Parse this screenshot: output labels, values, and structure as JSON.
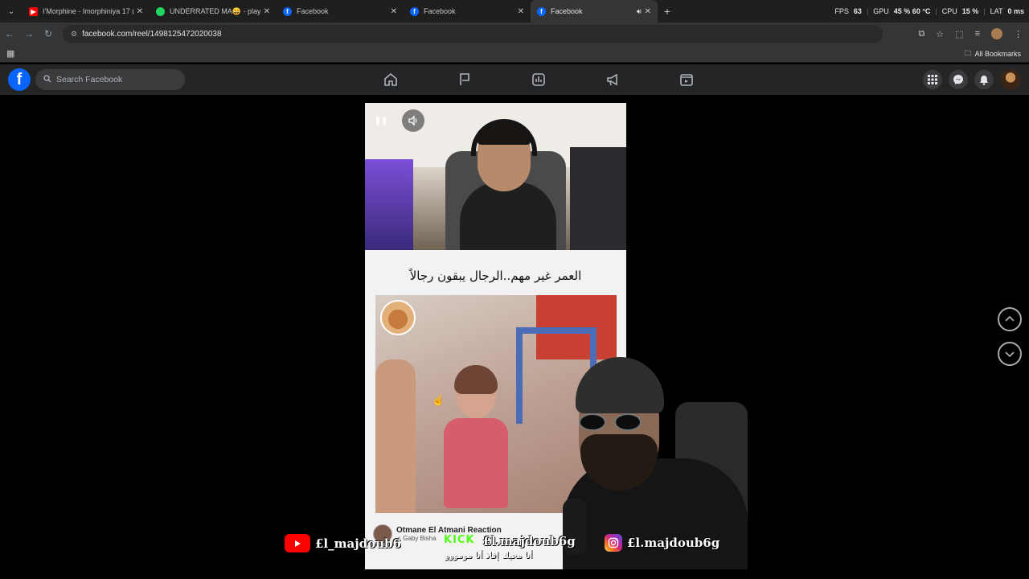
{
  "browser": {
    "tabs": [
      {
        "title": "I'Morphine - Imorphiniya 17 (O",
        "favicon_color": "#ff0000",
        "active": false
      },
      {
        "title": "UNDERRATED MA😄 - playlist",
        "favicon_color": "#1ed760",
        "active": false
      },
      {
        "title": "Facebook",
        "favicon_color": "#0866ff",
        "active": false
      },
      {
        "title": "Facebook",
        "favicon_color": "#0866ff",
        "active": false
      },
      {
        "title": "Facebook",
        "favicon_color": "#0866ff",
        "active": true
      }
    ],
    "stats": {
      "fps_label": "FPS",
      "fps_value": "63",
      "gpu_label": "GPU",
      "gpu_value": "45 % 60 °C",
      "cpu_label": "CPU",
      "cpu_value": "15 %",
      "lat_label": "LAT",
      "lat_value": "0 ms"
    },
    "url": "facebook.com/reel/1498125472020038",
    "bookmarks_label": "All Bookmarks"
  },
  "facebook": {
    "logo_letter": "f",
    "search_placeholder": "Search Facebook"
  },
  "reel": {
    "caption": "العمر غير مهم..الرجال يبقون رجالاً",
    "author_name": "Otmane El Atmani Reaction",
    "song": "♫ Gaby Bisha"
  },
  "overlay": {
    "youtube_handle": "£l_majdoub6",
    "kick_logo": "KICK",
    "kick_handle": "£l.majdoub6g",
    "instagram_handle": "£l.majdoub6g",
    "subtitle": "أنا محيك إفاذ أنا مومووو"
  },
  "colors": {
    "fb_blue": "#0866ff",
    "fb_header": "#242526",
    "youtube_red": "#ff0000",
    "kick_green": "#53fc18"
  }
}
